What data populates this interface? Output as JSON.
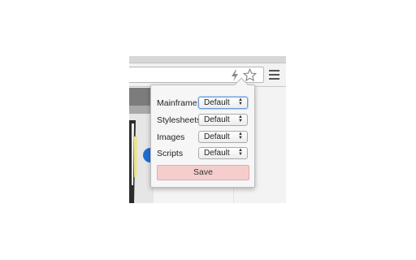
{
  "popup": {
    "rows": [
      {
        "label": "Mainframe",
        "value": "Default"
      },
      {
        "label": "Stylesheets",
        "value": "Default"
      },
      {
        "label": "Images",
        "value": "Default"
      },
      {
        "label": "Scripts",
        "value": "Default"
      }
    ],
    "save_label": "Save"
  },
  "icons": {
    "extension": "lightning-bolt-icon",
    "bookmark": "star-icon",
    "menu": "hamburger-menu-icon"
  },
  "colors": {
    "save_button_bg": "#f5cdcd",
    "focus_ring": "#6d9fd8"
  }
}
